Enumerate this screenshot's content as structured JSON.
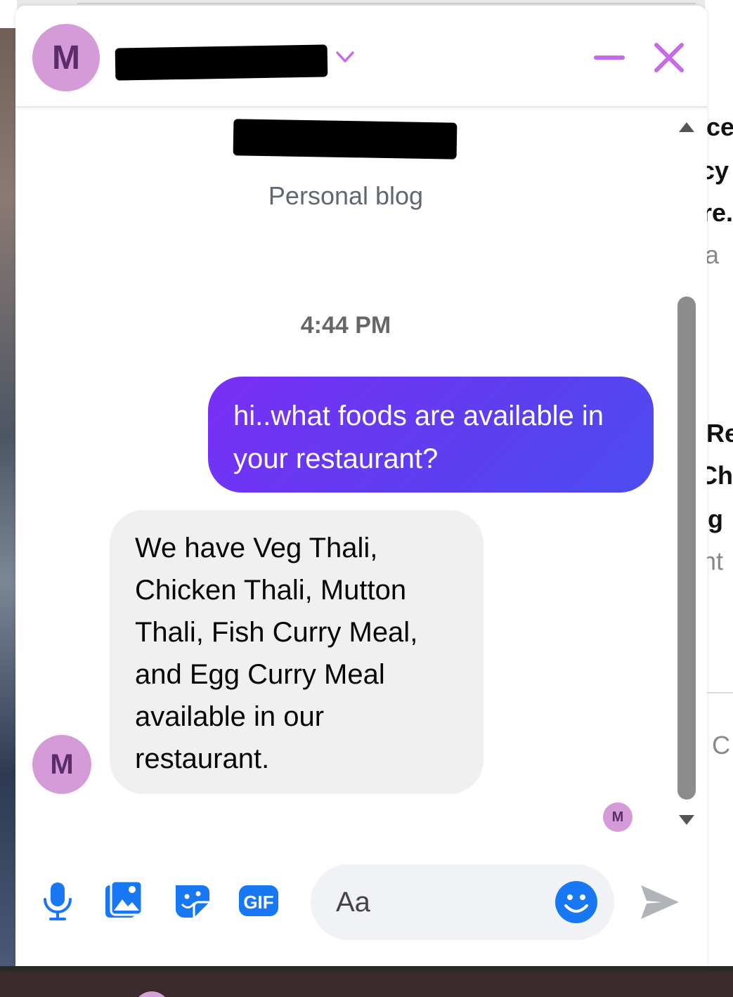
{
  "header": {
    "avatar_initial": "M"
  },
  "profile": {
    "subtitle": "Personal blog"
  },
  "conversation": {
    "timestamp": "4:44 PM",
    "outgoing_message": "hi..what foods are available in your restaurant?",
    "incoming_message": "We have Veg Thali, Chicken Thali, Mutton Thali, Fish Curry Meal, and Egg Curry Meal available in our restaurant.",
    "sender_initial": "M",
    "seen_initial": "M"
  },
  "composer": {
    "placeholder": "Aa",
    "gif_label": "GIF"
  },
  "background": {
    "right_fragments": [
      "ce",
      "cy",
      "re.",
      "la",
      "Re",
      "Ch",
      "ig",
      "nt",
      "C"
    ]
  },
  "colors": {
    "accent": "#c56ae8",
    "icon_blue": "#1877f2",
    "avatar": "#d59bd9",
    "bubble_out_start": "#7a2ff6",
    "bubble_out_end": "#4b4cf0",
    "bubble_in": "#f0f0f0"
  }
}
